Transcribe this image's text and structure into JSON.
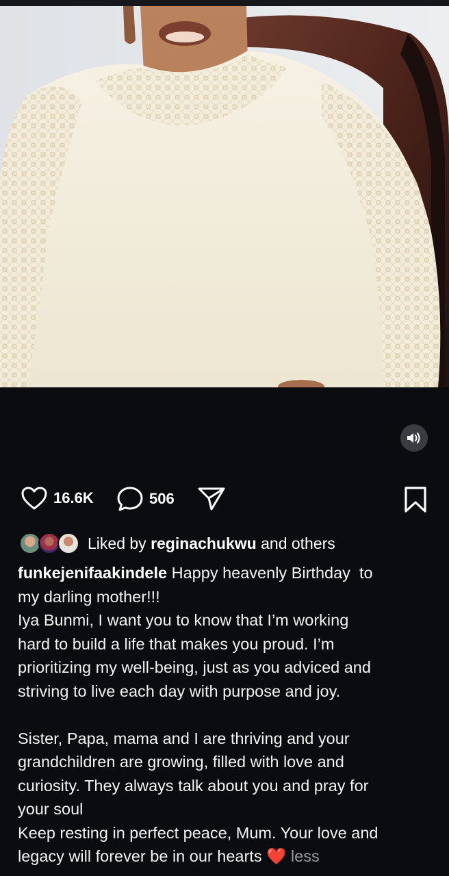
{
  "post": {
    "likes_count": "16.6K",
    "comments_count": "506"
  },
  "liked_by": {
    "prefix": "Liked by ",
    "user": "reginachukwu",
    "suffix": " and others"
  },
  "caption": {
    "username": "funkejenifaakindele",
    "line1": " Happy heavenly Birthday  to",
    "line2": "my darling mother!!!",
    "line3": "Iya Bunmi, I want you to know that I’m working",
    "line4": "hard to build a life that makes you proud. I’m",
    "line5": "prioritizing my well-being, just as you adviced and",
    "line6": "striving to live each day with purpose and joy.",
    "line7": "",
    "line8": "Sister, Papa, mama and I are thriving and your",
    "line9": "grandchildren are growing, filled with love and",
    "line10": "curiosity. They always talk about you and pray for",
    "line11": "your soul",
    "line12": "Keep resting in perfect peace, Mum. Your love and",
    "line13": "legacy will forever be in our hearts",
    "heart_emoji": "❤️",
    "less_label": "less"
  },
  "icons": {
    "like": "heart-outline-icon",
    "comment": "speech-bubble-icon",
    "share": "paper-plane-icon",
    "save": "bookmark-icon",
    "mute": "speaker-icon"
  },
  "colors": {
    "background": "#0b0c0f",
    "text": "#ffffff",
    "heart": "#e8262b",
    "muted": "#9a9aa0"
  }
}
